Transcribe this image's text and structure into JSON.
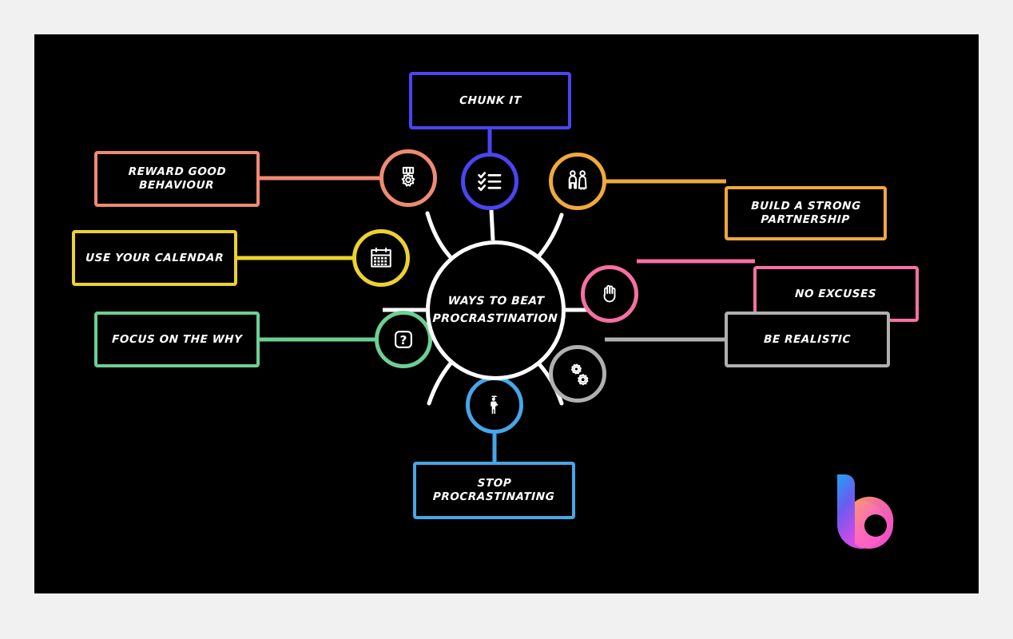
{
  "page": {
    "background_color": "#f1f1f1",
    "canvas_color": "#000000"
  },
  "center": {
    "label": "WAYS TO BEAT\nPROCRASTINATION",
    "line1": "WAYS TO BEAT",
    "line2": "PROCRASTINATION",
    "border_color": "#ffffff"
  },
  "brand": {
    "name": "b-logo",
    "gradient_start": "#2196f3",
    "gradient_mid": "#a04bef",
    "gradient_end": "#ff4fd8"
  },
  "nodes": [
    {
      "id": "chunk-it",
      "label": "CHUNK IT",
      "color": "#4a45f0",
      "icon": "checklist-icon",
      "position": "top"
    },
    {
      "id": "reward-good-behaviour",
      "label": "REWARD GOOD BEHAVIOUR",
      "color": "#f08a72",
      "icon": "medal-icon",
      "position": "left-top"
    },
    {
      "id": "use-your-calendar",
      "label": "USE YOUR CALENDAR",
      "color": "#edd12f",
      "icon": "calendar-icon",
      "position": "left-middle"
    },
    {
      "id": "focus-on-the-why",
      "label": "FOCUS ON THE WHY",
      "color": "#6dcf93",
      "icon": "question-mark-icon",
      "position": "left-bottom"
    },
    {
      "id": "build-a-strong-partnership",
      "label": "BUILD A STRONG PARTNERSHIP",
      "color": "#f0a93c",
      "icon": "two-people-icon",
      "position": "right-top"
    },
    {
      "id": "no-excuses",
      "label": "NO EXCUSES",
      "color": "#f76fa5",
      "icon": "stop-hand-icon",
      "position": "right-middle"
    },
    {
      "id": "be-realistic",
      "label": "BE REALISTIC",
      "color": "#b0b0b0",
      "icon": "gears-icon",
      "position": "right-bottom"
    },
    {
      "id": "stop-procrastinating",
      "label": "STOP PROCRASTINATING",
      "color": "#46a6e8",
      "icon": "standing-person-icon",
      "position": "bottom"
    }
  ]
}
